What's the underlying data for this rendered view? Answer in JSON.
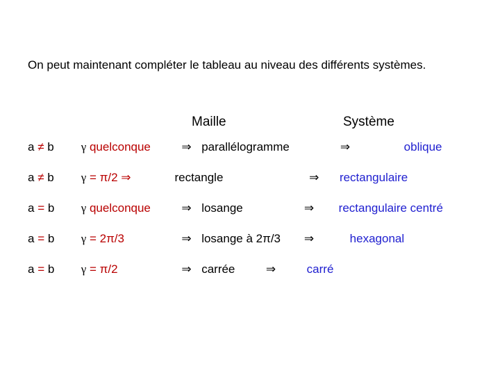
{
  "intro": "On peut maintenant compléter le tableau au niveau des différents systèmes.",
  "headers": {
    "maille": "Maille",
    "systeme": "Système"
  },
  "implies": "⇒",
  "rows": [
    {
      "cond_a": "a",
      "cond_op": "≠",
      "cond_b": "b",
      "gamma": "γ",
      "gamma_sub": " quelconque",
      "arrow1": "⇒",
      "maille": "parallélogramme",
      "arrow2": "⇒",
      "system": "oblique"
    },
    {
      "cond_a": "a",
      "cond_op": "≠",
      "cond_b": "b",
      "gamma": "γ",
      "gamma_sub": " = π/2 ⇒",
      "arrow1": "",
      "maille": "rectangle",
      "arrow2": "⇒",
      "system": "rectangulaire"
    },
    {
      "cond_a": "a",
      "cond_op": " = ",
      "cond_b": "b",
      "gamma": "γ",
      "gamma_sub": " quelconque",
      "arrow1": "⇒",
      "maille": "losange",
      "arrow2": "⇒",
      "system": "rectangulaire centré"
    },
    {
      "cond_a": "a",
      "cond_op": " = ",
      "cond_b": "b",
      "gamma": "γ",
      "gamma_sub": " = 2π/3",
      "arrow1": "⇒",
      "maille": "losange à 2π/3",
      "arrow2": "⇒",
      "system": "hexagonal"
    },
    {
      "cond_a": "a",
      "cond_op": " = ",
      "cond_b": "b",
      "gamma": "γ",
      "gamma_sub": " = π/2",
      "arrow1": "⇒",
      "maille": "carrée",
      "arrow2": "⇒",
      "system": "carré"
    }
  ]
}
